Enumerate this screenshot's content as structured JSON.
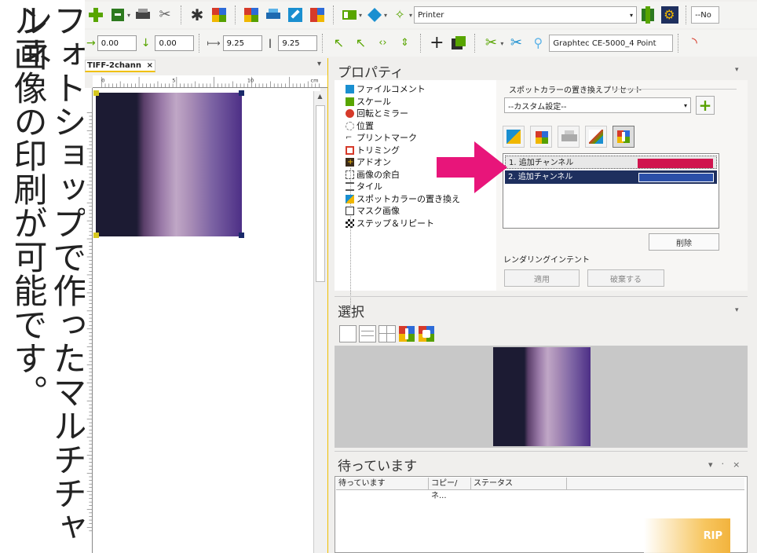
{
  "caption": {
    "line1": "フォトショップで作ったマルチチャンネ",
    "line2": "ル画像の印刷が可能です。"
  },
  "toolbar": {
    "printer_combo": "Printer",
    "right_combo": "--No",
    "x_value": "0.00",
    "y_value": "0.00",
    "width_value": "9.25",
    "height_value": "9.25",
    "cutter_combo": "Graphtec CE-5000_4 Point"
  },
  "document": {
    "tab_title": "TIFF-2chann",
    "tab_close": "×",
    "ruler_unit": "cm",
    "ruler_labels": [
      "0",
      "5",
      "10"
    ]
  },
  "properties": {
    "title": "プロパティ",
    "tree": [
      "ファイルコメント",
      "スケール",
      "回転とミラー",
      "位置",
      "プリントマーク",
      "トリミング",
      "アドオン",
      "画像の余白",
      "タイル",
      "スポットカラーの置き換え",
      "マスク画像",
      "ステップ＆リピート"
    ],
    "preset_group_label": "スポットカラーの置き換えプリセット",
    "preset_value": "--カスタム設定--",
    "add_label": "+",
    "channels": [
      {
        "label": "1. 追加チャンネル",
        "color": "#d0154e"
      },
      {
        "label": "2. 追加チャンネル",
        "color": "#2b4fa8"
      }
    ],
    "delete_button": "削除",
    "rendering_intent_label": "レンダリングインテント",
    "apply_button": "適用",
    "discard_button": "破棄する"
  },
  "selection": {
    "title": "選択"
  },
  "queue": {
    "title": "待っています",
    "controls": "▾ ᛫ ×",
    "columns": [
      "待っています",
      "コピー/ネ...",
      "ステータス"
    ],
    "rip_button": "RIP"
  },
  "colors": {
    "accent_pink": "#e8157a",
    "selected_row": "#1e2f5e",
    "green_add": "#57a000"
  }
}
